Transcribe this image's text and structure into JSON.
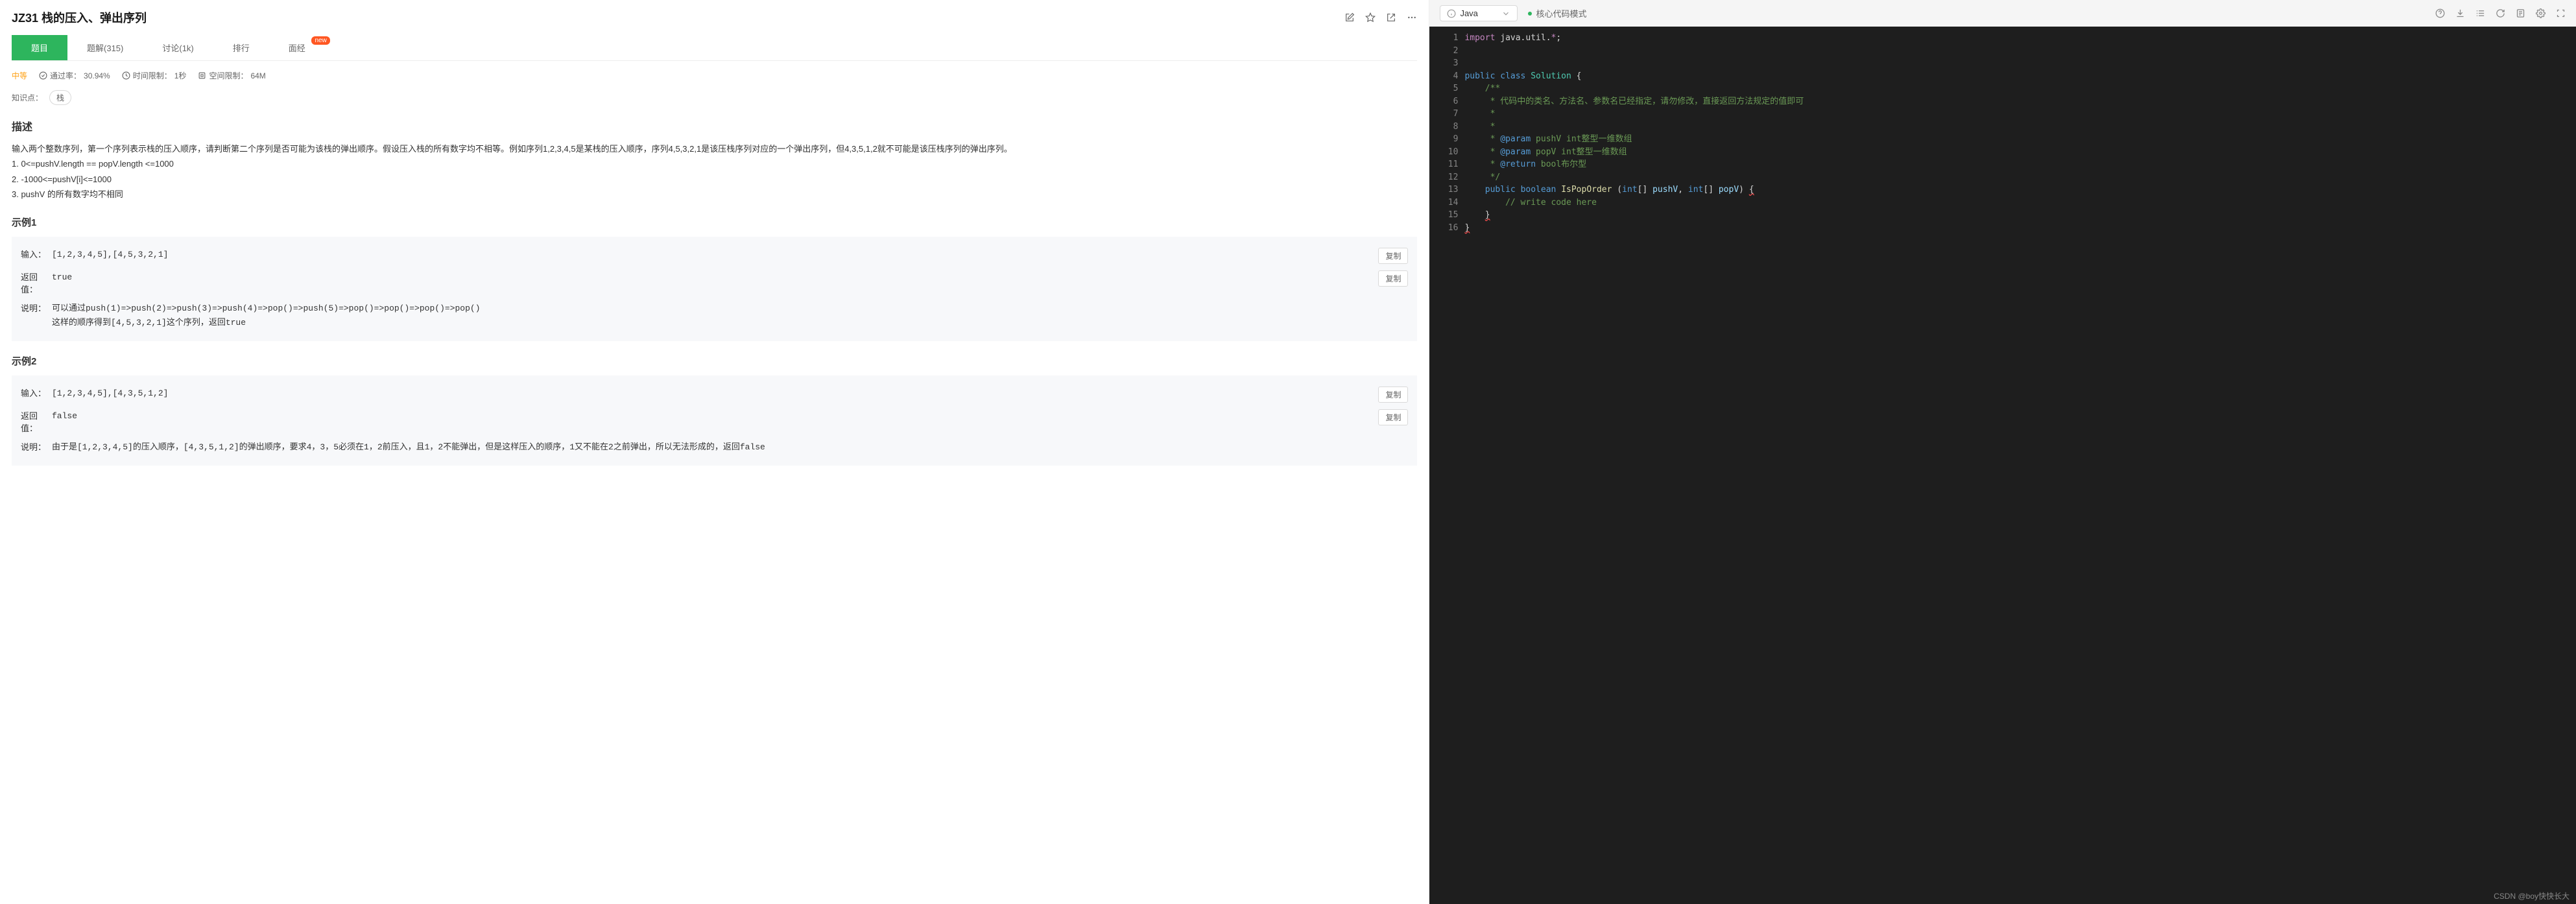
{
  "header": {
    "title": "JZ31 栈的压入、弹出序列"
  },
  "tabs": {
    "items": [
      {
        "label": "题目",
        "active": true
      },
      {
        "label": "题解(315)"
      },
      {
        "label": "讨论(1k)"
      },
      {
        "label": "排行"
      },
      {
        "label": "面经",
        "badge": "new"
      }
    ]
  },
  "meta": {
    "difficulty": "中等",
    "pass_rate_label": "通过率：",
    "pass_rate_value": "30.94%",
    "time_limit_label": "时间限制：",
    "time_limit_value": "1秒",
    "space_limit_label": "空间限制：",
    "space_limit_value": "64M"
  },
  "knowledge": {
    "label": "知识点：",
    "tags": [
      "栈"
    ]
  },
  "description": {
    "heading": "描述",
    "text": "输入两个整数序列，第一个序列表示栈的压入顺序，请判断第二个序列是否可能为该栈的弹出顺序。假设压入栈的所有数字均不相等。例如序列1,2,3,4,5是某栈的压入顺序，序列4,5,3,2,1是该压栈序列对应的一个弹出序列，但4,3,5,1,2就不可能是该压栈序列的弹出序列。\n1. 0<=pushV.length == popV.length <=1000\n2. -1000<=pushV[i]<=1000\n3. pushV 的所有数字均不相同"
  },
  "examples": [
    {
      "heading": "示例1",
      "input_label": "输入：",
      "input_value": "[1,2,3,4,5],[4,5,3,2,1]",
      "return_label": "返回值：",
      "return_value": "true",
      "note_label": "说明：",
      "note_value": "可以通过push(1)=>push(2)=>push(3)=>push(4)=>pop()=>push(5)=>pop()=>pop()=>pop()=>pop()\n这样的顺序得到[4,5,3,2,1]这个序列，返回true",
      "copy_label": "复制"
    },
    {
      "heading": "示例2",
      "input_label": "输入：",
      "input_value": "[1,2,3,4,5],[4,3,5,1,2]",
      "return_label": "返回值：",
      "return_value": "false",
      "note_label": "说明：",
      "note_value": "由于是[1,2,3,4,5]的压入顺序，[4,3,5,1,2]的弹出顺序，要求4，3，5必须在1，2前压入，且1，2不能弹出，但是这样压入的顺序，1又不能在2之前弹出，所以无法形成的，返回false",
      "copy_label": "复制"
    }
  ],
  "editor": {
    "language": "Java",
    "mode_label": "核心代码模式",
    "lines": [
      [
        {
          "t": "kw",
          "v": "import"
        },
        {
          "t": "p",
          "v": " java.util."
        },
        {
          "t": "kw",
          "v": "*"
        },
        {
          "t": "p",
          "v": ";"
        }
      ],
      [],
      [],
      [
        {
          "t": "kw2",
          "v": "public"
        },
        {
          "t": "p",
          "v": " "
        },
        {
          "t": "kw2",
          "v": "class"
        },
        {
          "t": "p",
          "v": " "
        },
        {
          "t": "type",
          "v": "Solution"
        },
        {
          "t": "p",
          "v": " {"
        }
      ],
      [
        {
          "t": "p",
          "v": "    "
        },
        {
          "t": "com",
          "v": "/**"
        }
      ],
      [
        {
          "t": "p",
          "v": "    "
        },
        {
          "t": "com",
          "v": " * 代码中的类名、方法名、参数名已经指定，请勿修改，直接返回方法规定的值即可"
        }
      ],
      [
        {
          "t": "p",
          "v": "    "
        },
        {
          "t": "com",
          "v": " *"
        }
      ],
      [
        {
          "t": "p",
          "v": "    "
        },
        {
          "t": "com",
          "v": " * "
        }
      ],
      [
        {
          "t": "p",
          "v": "    "
        },
        {
          "t": "com",
          "v": " * "
        },
        {
          "t": "tag",
          "v": "@param"
        },
        {
          "t": "com",
          "v": " pushV int整型一维数组 "
        }
      ],
      [
        {
          "t": "p",
          "v": "    "
        },
        {
          "t": "com",
          "v": " * "
        },
        {
          "t": "tag",
          "v": "@param"
        },
        {
          "t": "com",
          "v": " popV int整型一维数组 "
        }
      ],
      [
        {
          "t": "p",
          "v": "    "
        },
        {
          "t": "com",
          "v": " * "
        },
        {
          "t": "tag",
          "v": "@return"
        },
        {
          "t": "com",
          "v": " bool布尔型"
        }
      ],
      [
        {
          "t": "p",
          "v": "    "
        },
        {
          "t": "com",
          "v": " */"
        }
      ],
      [
        {
          "t": "p",
          "v": "    "
        },
        {
          "t": "kw2",
          "v": "public"
        },
        {
          "t": "p",
          "v": " "
        },
        {
          "t": "kw2",
          "v": "boolean"
        },
        {
          "t": "p",
          "v": " "
        },
        {
          "t": "fn",
          "v": "IsPopOrder"
        },
        {
          "t": "p",
          "v": " ("
        },
        {
          "t": "kw2",
          "v": "int"
        },
        {
          "t": "p",
          "v": "[] "
        },
        {
          "t": "param",
          "v": "pushV"
        },
        {
          "t": "p",
          "v": ", "
        },
        {
          "t": "kw2",
          "v": "int"
        },
        {
          "t": "p",
          "v": "[] "
        },
        {
          "t": "param",
          "v": "popV"
        },
        {
          "t": "p",
          "v": ") "
        },
        {
          "t": "sq",
          "v": "{"
        }
      ],
      [
        {
          "t": "p",
          "v": "        "
        },
        {
          "t": "com",
          "v": "// write code here"
        }
      ],
      [
        {
          "t": "p",
          "v": "    "
        },
        {
          "t": "sq",
          "v": "}"
        }
      ],
      [
        {
          "t": "sq",
          "v": "}"
        }
      ]
    ]
  },
  "watermark": "CSDN @boy快快长大"
}
